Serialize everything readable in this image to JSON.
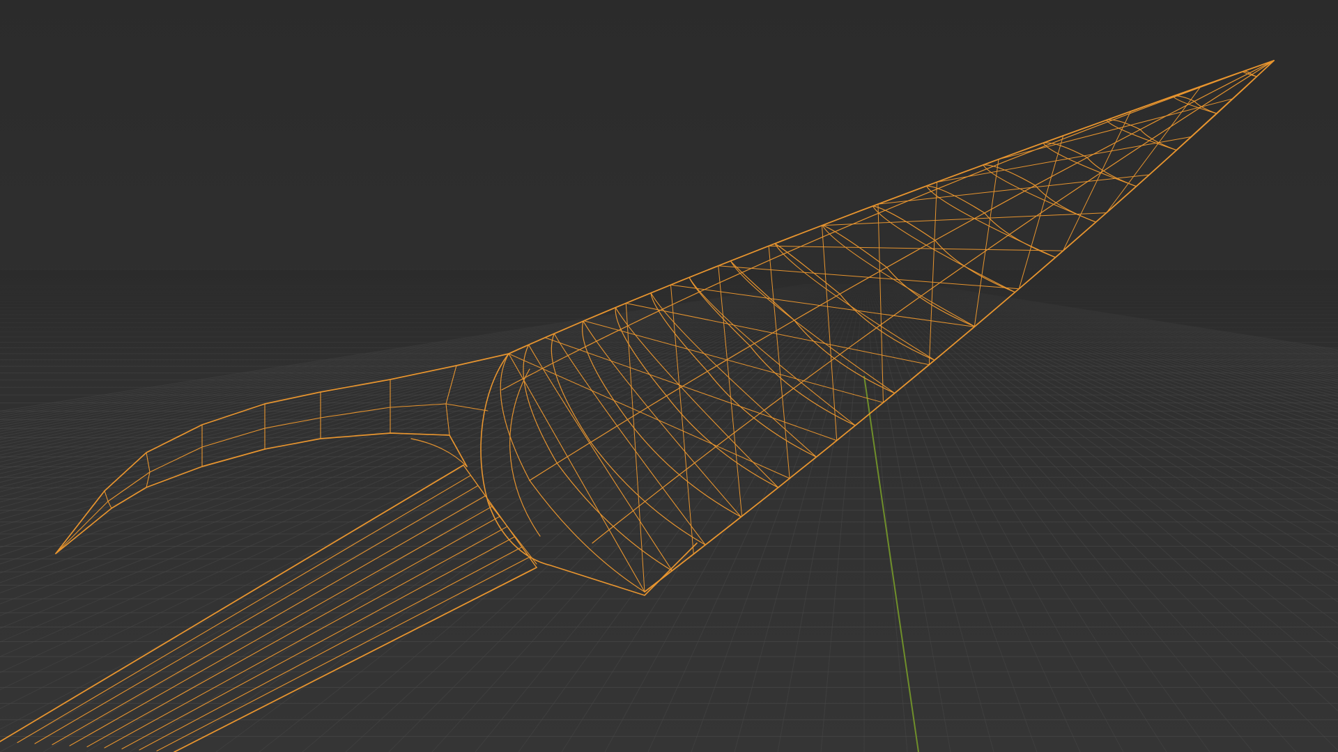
{
  "viewport": {
    "label": "",
    "background_top": "#2b2b2b",
    "background_bottom": "#353535",
    "grid_color": "#474747",
    "y_axis_color": "#6f8f2a",
    "wire_color": "#e8952f"
  },
  "object": {
    "name": "",
    "display_mode": "wireframe",
    "selected": true
  }
}
